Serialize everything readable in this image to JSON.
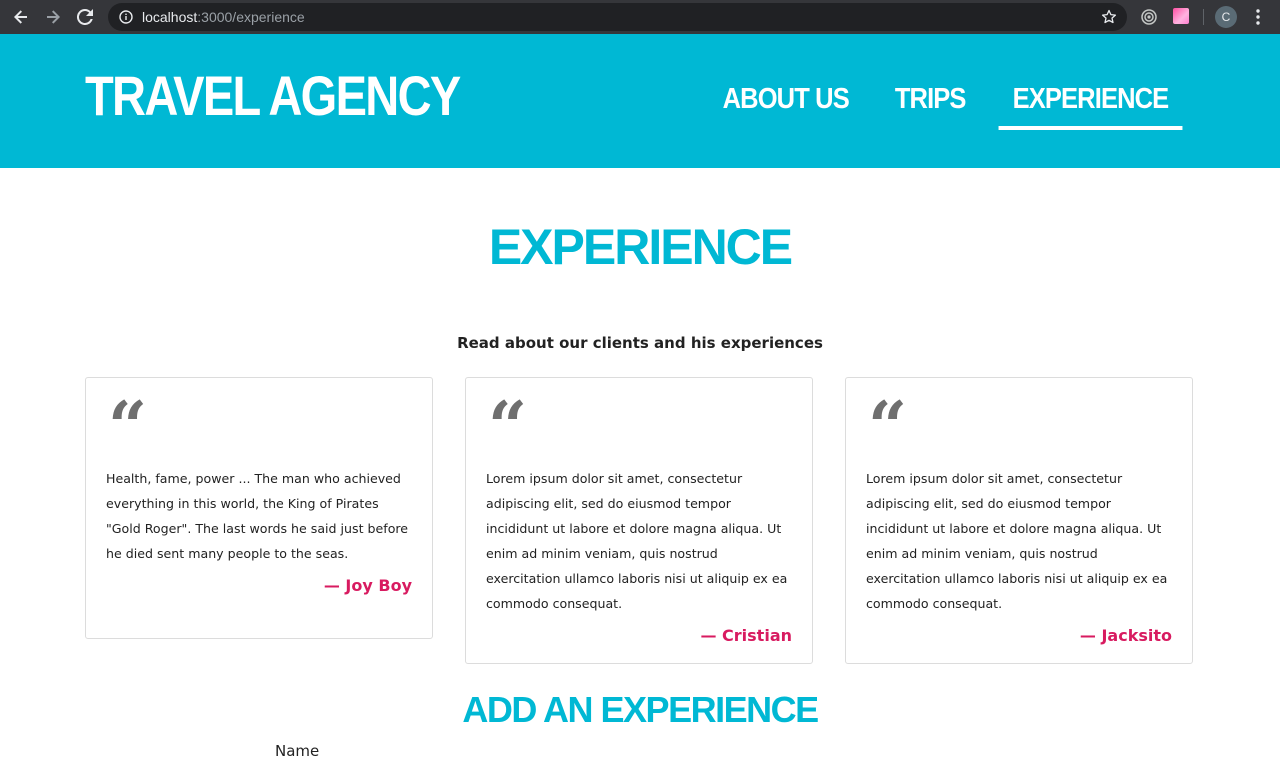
{
  "browser": {
    "url_host": "localhost",
    "url_path": ":3000/experience",
    "profile_initial": "C"
  },
  "site": {
    "brand": "Travel Agency",
    "nav": [
      {
        "label": "About Us",
        "active": false
      },
      {
        "label": "Trips",
        "active": false
      },
      {
        "label": "Experience",
        "active": true
      }
    ]
  },
  "page": {
    "title": "Experience",
    "intro": "Read about our clients and his experiences",
    "testimonials": [
      {
        "text": "Health, fame, power ... The man who achieved everything in this world, the King of Pirates \"Gold Roger\". The last words he said just before he died sent many people to the seas.",
        "author": "— Joy Boy"
      },
      {
        "text": "Lorem ipsum dolor sit amet, consectetur adipiscing elit, sed do eiusmod tempor incididunt ut labore et dolore magna aliqua. Ut enim ad minim veniam, quis nostrud exercitation ullamco laboris nisi ut aliquip ex ea commodo consequat.",
        "author": "— Cristian"
      },
      {
        "text": "Lorem ipsum dolor sit amet, consectetur adipiscing elit, sed do eiusmod tempor incididunt ut labore et dolore magna aliqua. Ut enim ad minim veniam, quis nostrud exercitation ullamco laboris nisi ut aliquip ex ea commodo consequat.",
        "author": "— Jacksito"
      }
    ],
    "quote_glyph": "“",
    "add_title": "Add an Experience",
    "form": {
      "name_label": "Name"
    }
  },
  "colors": {
    "brand": "#00b8d4",
    "author": "#d81b60",
    "chrome": "#35363a"
  }
}
